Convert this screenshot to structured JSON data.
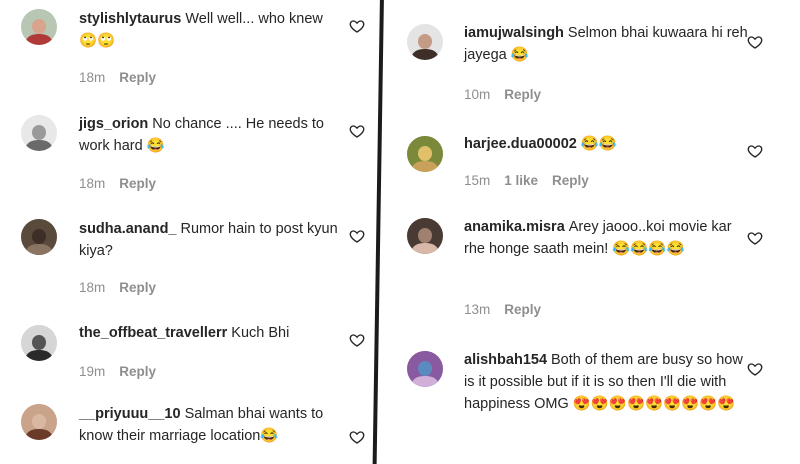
{
  "left_comments": [
    {
      "username": "stylishlytaurus",
      "text": "Well well... who knew 🙄🙄",
      "time": "18m",
      "likes": "",
      "reply": "Reply",
      "avatar_colors": [
        "#b8c6b4",
        "#b03a3a",
        "#d9a48c"
      ]
    },
    {
      "username": "jigs_orion",
      "text": "No chance .... He needs to work hard 😂",
      "time": "18m",
      "likes": "",
      "reply": "Reply",
      "avatar_colors": [
        "#e8e8e8",
        "#6a6a6a",
        "#9a9a9a"
      ]
    },
    {
      "username": "sudha.anand_",
      "text": "Rumor hain to post kyun kiya?",
      "time": "18m",
      "likes": "",
      "reply": "Reply",
      "avatar_colors": [
        "#5a4a3c",
        "#8a7562",
        "#3d2f27"
      ]
    },
    {
      "username": "the_offbeat_travellerr",
      "text": "Kuch Bhi",
      "time": "19m",
      "likes": "",
      "reply": "Reply",
      "avatar_colors": [
        "#d6d6d6",
        "#2a2a2a",
        "#555555"
      ]
    },
    {
      "username": "__priyuuu__10",
      "text": "Salman bhai wants to know their marriage location😂",
      "time": "",
      "likes": "",
      "reply": "",
      "avatar_colors": [
        "#c9a38a",
        "#6b3b2a",
        "#d9b8a3"
      ]
    }
  ],
  "right_comments": [
    {
      "username": "iamujwalsingh",
      "text": "Selmon bhai kuwaara hi reh jayega 😂",
      "time": "10m",
      "likes": "",
      "reply": "Reply",
      "avatar_colors": [
        "#e4e4e4",
        "#3d2e28",
        "#c49b85"
      ]
    },
    {
      "username": "harjee.dua00002",
      "text": "😂😂",
      "time": "15m",
      "likes": "1 like",
      "reply": "Reply",
      "avatar_colors": [
        "#7a8a3a",
        "#c9a15a",
        "#e0c06a"
      ]
    },
    {
      "username": "anamika.misra",
      "text": "Arey jaooo..koi movie kar rhe honge saath mein! 😂😂😂😂",
      "time": "13m",
      "likes": "",
      "reply": "Reply",
      "avatar_colors": [
        "#4a3a34",
        "#d8b8a8",
        "#a08070"
      ]
    },
    {
      "username": "alishbah154",
      "text": "Both of them are busy so how is it possible but if it is so then I'll die with happiness OMG 😍😍😍😍😍😍😍😍😍",
      "time": "",
      "likes": "",
      "reply": "",
      "avatar_colors": [
        "#8a5aa0",
        "#d0b0d8",
        "#5a8ac0"
      ]
    }
  ],
  "icons": {
    "like": "heart-outline-icon"
  },
  "colors": {
    "text": "#262626",
    "meta": "#8e8e8e",
    "divider": "#1b1b1b"
  }
}
